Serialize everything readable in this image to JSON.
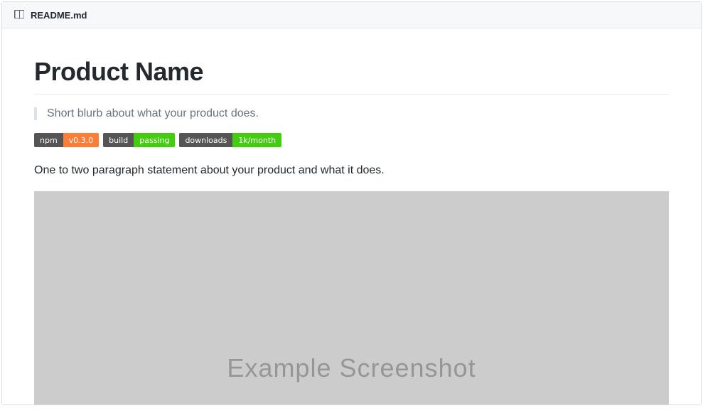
{
  "header": {
    "filename": "README.md"
  },
  "content": {
    "title": "Product Name",
    "blurb": "Short blurb about what your product does.",
    "description": "One to two paragraph statement about your product and what it does.",
    "screenshot_label": "Example Screenshot"
  },
  "badges": [
    {
      "left": "npm",
      "right": "v0.3.0",
      "color": "orange"
    },
    {
      "left": "build",
      "right": "passing",
      "color": "green"
    },
    {
      "left": "downloads",
      "right": "1k/month",
      "color": "green"
    }
  ]
}
